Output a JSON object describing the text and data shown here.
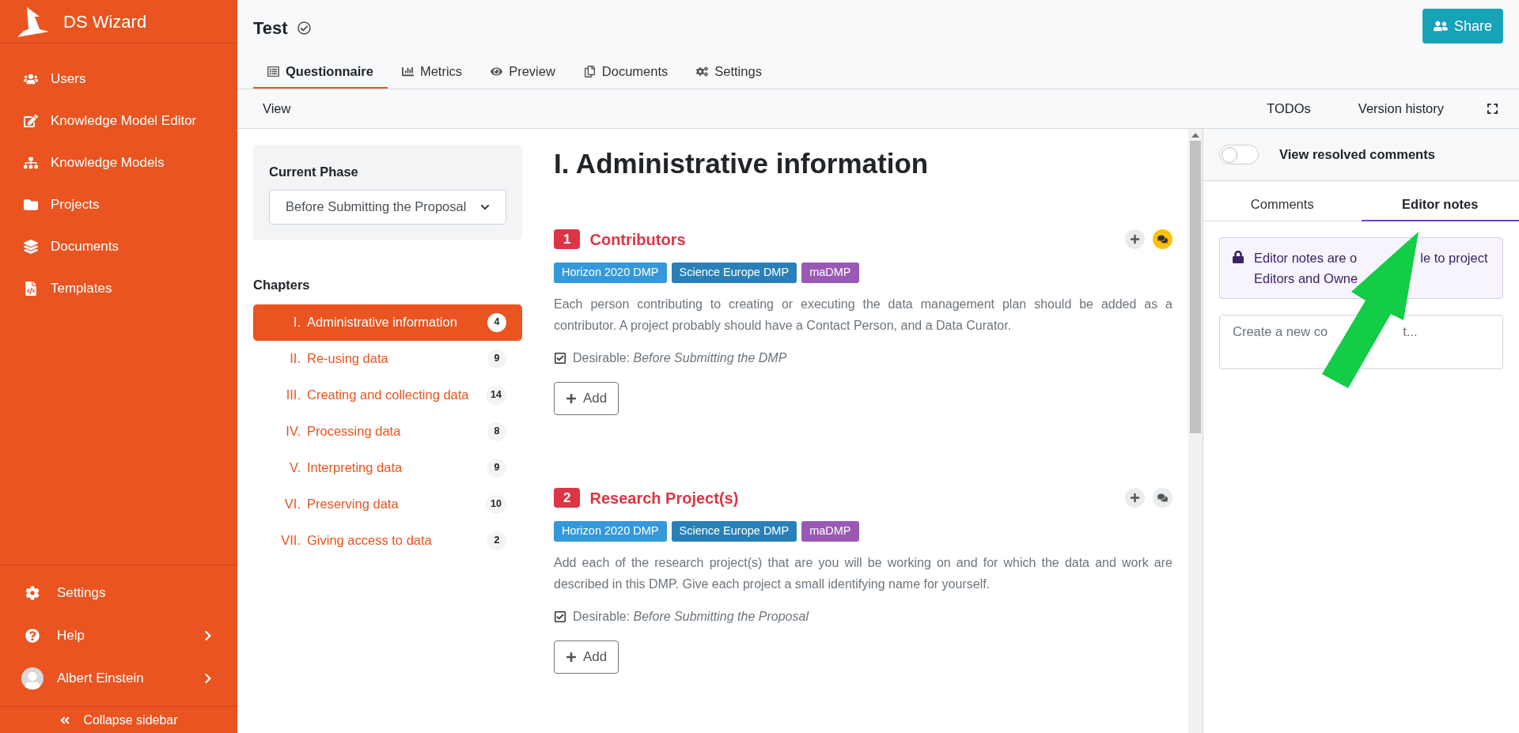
{
  "sidebar": {
    "brand": "DS Wizard",
    "items": [
      {
        "label": "Users"
      },
      {
        "label": "Knowledge Model Editor"
      },
      {
        "label": "Knowledge Models"
      },
      {
        "label": "Projects"
      },
      {
        "label": "Documents"
      },
      {
        "label": "Templates"
      }
    ],
    "bottom_items": [
      {
        "label": "Settings",
        "has_submenu": false
      },
      {
        "label": "Help",
        "has_submenu": true
      },
      {
        "label": "Albert Einstein",
        "has_submenu": true
      }
    ],
    "collapse": "Collapse sidebar"
  },
  "header": {
    "title": "Test",
    "share": "Share",
    "tabs": [
      {
        "label": "Questionnaire",
        "selected": true
      },
      {
        "label": "Metrics",
        "selected": false
      },
      {
        "label": "Preview",
        "selected": false
      },
      {
        "label": "Documents",
        "selected": false
      },
      {
        "label": "Settings",
        "selected": false
      }
    ]
  },
  "toolbar": {
    "left": [
      "View"
    ],
    "right": [
      "TODOs",
      "Version history"
    ]
  },
  "phase": {
    "label": "Current Phase",
    "value": "Before Submitting the Proposal"
  },
  "chapters": {
    "title": "Chapters",
    "items": [
      {
        "number": "I.",
        "label": "Administrative information",
        "count": "4",
        "selected": true
      },
      {
        "number": "II.",
        "label": "Re-using data",
        "count": "9",
        "selected": false
      },
      {
        "number": "III.",
        "label": "Creating and collecting data",
        "count": "14",
        "selected": false
      },
      {
        "number": "IV.",
        "label": "Processing data",
        "count": "8",
        "selected": false
      },
      {
        "number": "V.",
        "label": "Interpreting data",
        "count": "9",
        "selected": false
      },
      {
        "number": "VI.",
        "label": "Preserving data",
        "count": "10",
        "selected": false
      },
      {
        "number": "VII.",
        "label": "Giving access to data",
        "count": "2",
        "selected": false
      }
    ]
  },
  "chapter_title": "I. Administrative information",
  "questions": [
    {
      "number": "1",
      "title": "Contributors",
      "tags": [
        {
          "label": "Horizon 2020 DMP",
          "color": "#3498db"
        },
        {
          "label": "Science Europe DMP",
          "color": "#2980b9"
        },
        {
          "label": "maDMP",
          "color": "#9b59b6"
        }
      ],
      "text": "Each person contributing to creating or executing the data management plan should be added as a contributor. A project probably should have a Contact Person, and a Data Curator.",
      "desirable_label": "Desirable:",
      "desirable_phase": "Before Submitting the DMP",
      "add": "Add",
      "has_comments": true
    },
    {
      "number": "2",
      "title": "Research Project(s)",
      "tags": [
        {
          "label": "Horizon 2020 DMP",
          "color": "#3498db"
        },
        {
          "label": "Science Europe DMP",
          "color": "#2980b9"
        },
        {
          "label": "maDMP",
          "color": "#9b59b6"
        }
      ],
      "text": "Add each of the research project(s) that are you will be working on and for which the data and work are described in this DMP. Give each project a small identifying name for yourself.",
      "desirable_label": "Desirable:",
      "desirable_phase": "Before Submitting the Proposal",
      "add": "Add",
      "has_comments": false
    }
  ],
  "comments_panel": {
    "toggle": {
      "label": "View resolved comments",
      "on": false
    },
    "tabs": [
      {
        "label": "Comments",
        "selected": false
      },
      {
        "label": "Editor notes",
        "selected": true
      }
    ],
    "notice_lines": [
      [
        "Editor notes are o",
        "le to project"
      ],
      [
        "Editors and Owne"
      ]
    ],
    "placeholder_parts": [
      "Create a new co",
      "t..."
    ]
  }
}
